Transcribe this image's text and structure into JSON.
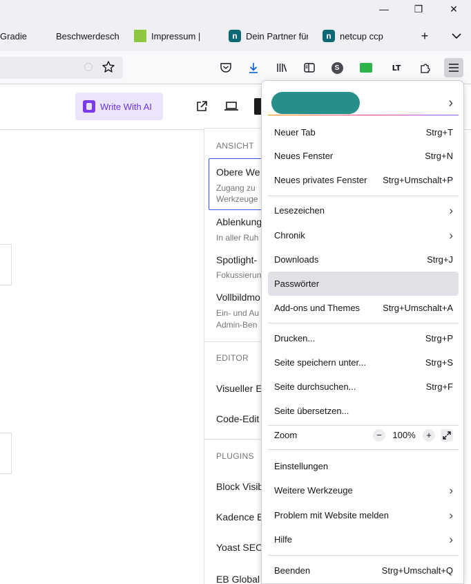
{
  "window_controls": {
    "minimize": "—",
    "restore": "❐",
    "close": "✕"
  },
  "tabs": [
    {
      "label": "Gradie",
      "favicon": "none",
      "color": ""
    },
    {
      "label": "Beschwerdeschr",
      "favicon": "none",
      "color": ""
    },
    {
      "label": "Impressum |",
      "favicon": "square",
      "color": "#8dc63f"
    },
    {
      "label": "Dein Partner für",
      "favicon": "netcup-n",
      "color": "#0e6775"
    },
    {
      "label": "netcup ccp",
      "favicon": "netcup-n",
      "color": "#0e6775"
    }
  ],
  "tabstrip": {
    "new_tab": "+",
    "list_tabs": "⌄"
  },
  "toolbar_icons": [
    "star-icon",
    "pocket-icon",
    "downloads-icon",
    "library-icon",
    "sidebar-icon",
    "extension-s-icon",
    "extension-green-icon",
    "languagetool-icon",
    "extensions-icon",
    "menu-icon"
  ],
  "page": {
    "ai_button": "Write With AI",
    "icons": [
      "open-external-icon",
      "laptop-preview-icon"
    ]
  },
  "options_panel": {
    "sections": [
      {
        "title": "ANSICHT"
      },
      {
        "title": "EDITOR"
      },
      {
        "title": "PLUGINS"
      }
    ],
    "items": {
      "obere": "Obere We",
      "obere_desc_1": "Zugang zu",
      "obere_desc_2": "Werkzeuge",
      "ablenkung": "Ablenkung",
      "ablenkung_desc": "In aller Ruh",
      "spotlight": "Spotlight-",
      "spotlight_desc": "Fokussierun",
      "vollbild": "Vollbildmo",
      "vollbild_desc_1": "Ein- und Au",
      "vollbild_desc_2": "Admin-Ben",
      "visueller": "Visueller E",
      "code": "Code-Edit",
      "block": "Block Visib",
      "kadence": "Kadence B",
      "yoast": "Yoast SEO",
      "eb": "EB Global"
    }
  },
  "menu": {
    "account_chevron": "›",
    "groups": [
      [
        {
          "label": "Neuer Tab",
          "shortcut": "Strg+T"
        },
        {
          "label": "Neues Fenster",
          "shortcut": "Strg+N"
        },
        {
          "label": "Neues privates Fenster",
          "shortcut": "Strg+Umschalt+P"
        }
      ],
      [
        {
          "label": "Lesezeichen",
          "chevron": "›"
        },
        {
          "label": "Chronik",
          "chevron": "›"
        },
        {
          "label": "Downloads",
          "shortcut": "Strg+J"
        },
        {
          "label": "Passwörter",
          "highlighted": true
        },
        {
          "label": "Add-ons und Themes",
          "shortcut": "Strg+Umschalt+A"
        }
      ],
      [
        {
          "label": "Drucken...",
          "shortcut": "Strg+P"
        },
        {
          "label": "Seite speichern unter...",
          "shortcut": "Strg+S"
        },
        {
          "label": "Seite durchsuchen...",
          "shortcut": "Strg+F"
        },
        {
          "label": "Seite übersetzen..."
        }
      ],
      [
        {
          "label": "Zoom"
        }
      ],
      [
        {
          "label": "Einstellungen"
        },
        {
          "label": "Weitere Werkzeuge",
          "chevron": "›"
        },
        {
          "label": "Problem mit Website melden",
          "chevron": "›"
        },
        {
          "label": "Hilfe",
          "chevron": "›"
        }
      ],
      [
        {
          "label": "Beenden",
          "shortcut": "Strg+Umschalt+Q"
        }
      ]
    ],
    "zoom": {
      "minus": "−",
      "value": "100%",
      "plus": "+"
    }
  },
  "colors": {
    "accent": "#3858e9",
    "ai_purple": "#7c3aed",
    "account_teal": "#278f8a",
    "highlight": "#e0e0e6"
  }
}
